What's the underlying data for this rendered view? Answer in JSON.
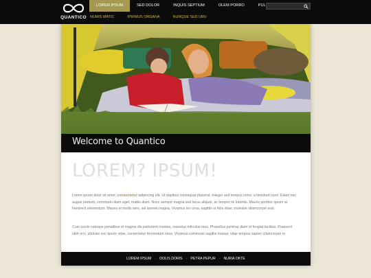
{
  "brand": {
    "name": "QUANTICO"
  },
  "main_nav": [
    {
      "label": "LOREM IPSUM",
      "active": true
    },
    {
      "label": "SED DOLOR",
      "active": false
    },
    {
      "label": "INQUIS SEPTIUM",
      "active": false
    },
    {
      "label": "OLEM PORRO",
      "active": false
    },
    {
      "label": "PULLUS IMPOUS",
      "active": false
    }
  ],
  "sub_nav": [
    {
      "label": "NUMIS MATIC"
    },
    {
      "label": "IPRIMUS ORGANA"
    },
    {
      "label": "NUNQUE SED URU"
    }
  ],
  "search": {
    "value": "",
    "icon": "search-icon"
  },
  "welcome": {
    "title": "Welcome to Quantico"
  },
  "content": {
    "headline": "LOREM? IPSUM!",
    "p1_before": "Lorem ipsum dolor sit amet, ",
    "p1_link": "consectetur",
    "p1_after": " adipiscing elit. Ut dapibus consequat placerat. Integer sed tempus tortor, a tincidunt nunc. Etiam nec augue pretium, commodo diam eget, mattis diam. Nunc semper magna sed lacus aliquet, ac tempor mi lobortis. Mauris porttitor ipsum at hendrerit elementum. Mauris et mollis sem, vel laoreet magna. Vivamus leo urna, sagittis ut felis vitae, molestie ullamcorper erat.",
    "p2": "Cum sociis natoque penatibus et magnis dis parturient montes, nascetur ridiculus mus. Phasellus pulvinar diam et feugiat facilisis. Praesent nibh orci, ultricies nec ipsum vitae, consectetur fermentum risus. Vivamus commodo sagittis massa, vitae tempus sapien ullamcorper in."
  },
  "footer": {
    "links": [
      "LOREM IPSUM",
      "DOLIS DORIS",
      "PETRA PEPUR",
      "NURIA OKTE"
    ],
    "separator": "-"
  },
  "colors": {
    "accent": "#a69a52",
    "link": "#d2b54a",
    "bar": "#0b0b0b",
    "background": "#ebe6d6"
  }
}
